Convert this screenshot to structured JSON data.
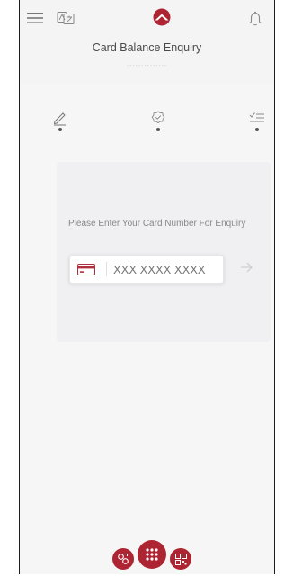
{
  "header": {
    "title": "Card Balance Enquiry",
    "title_dots": "..............",
    "icons": [
      "menu-icon",
      "translate-icon",
      "bank-logo",
      "bell-icon"
    ]
  },
  "steps": [
    {
      "icon": "pen-icon",
      "state": "active"
    },
    {
      "icon": "verify-icon",
      "state": "pending"
    },
    {
      "icon": "list-check-icon",
      "state": "pending"
    }
  ],
  "form": {
    "prompt": "Please Enter Your Card Number For Enquiry",
    "card_number_placeholder": "XXX XXXX XXXX",
    "card_icon": "credit-card-icon",
    "submit_icon": "arrow-right-icon"
  },
  "bottom_nav": [
    {
      "icon": "transfer-icon"
    },
    {
      "icon": "grid-menu-icon"
    },
    {
      "icon": "qr-icon"
    }
  ],
  "colors": {
    "accent": "#ad2432",
    "background": "#f4f4f5",
    "text": "#4a4a4a"
  }
}
